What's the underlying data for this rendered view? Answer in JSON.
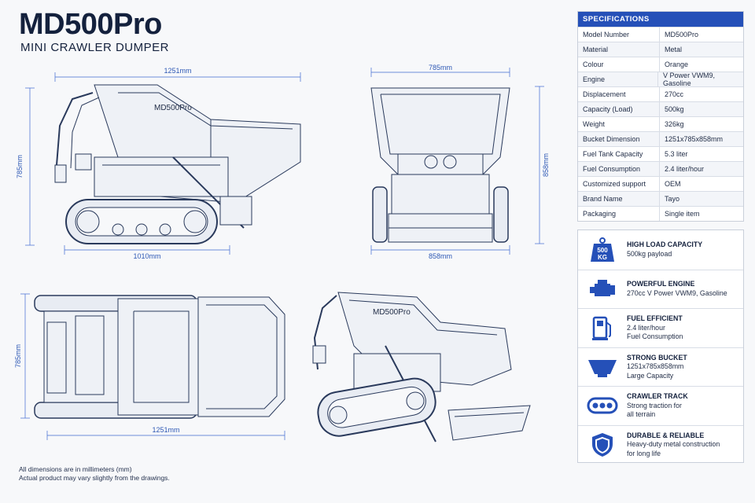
{
  "header": {
    "title": "MD500Pro",
    "subtitle": "MINI CRAWLER DUMPER"
  },
  "drawing": {
    "side_view": {
      "top_length": "1251mm",
      "height": "785mm",
      "track_length": "1010mm",
      "bucket_label": "MD500Pro"
    },
    "front_view": {
      "top_width": "785mm",
      "height": "858mm",
      "bottom_width": "858mm"
    },
    "top_view": {
      "width": "785mm",
      "length": "1251mm"
    },
    "iso_view": {
      "bucket_label": "MD500Pro"
    }
  },
  "notes": {
    "line1": "All dimensions are in millimeters (mm)",
    "line2": "Actual product may vary slightly from the drawings."
  },
  "specifications": {
    "heading": "SPECIFICATIONS",
    "rows": [
      {
        "key": "Model Number",
        "value": "MD500Pro"
      },
      {
        "key": "Material",
        "value": "Metal"
      },
      {
        "key": "Colour",
        "value": "Orange"
      },
      {
        "key": "Engine",
        "value": "V Power VWM9, Gasoline"
      },
      {
        "key": "Displacement",
        "value": "270cc"
      },
      {
        "key": "Capacity (Load)",
        "value": "500kg"
      },
      {
        "key": "Weight",
        "value": "326kg"
      },
      {
        "key": "Bucket Dimension",
        "value": "1251x785x858mm"
      },
      {
        "key": "Fuel Tank Capacity",
        "value": "5.3 liter"
      },
      {
        "key": "Fuel Consumption",
        "value": "2.4 liter/hour"
      },
      {
        "key": "Customized support",
        "value": "OEM"
      },
      {
        "key": "Brand Name",
        "value": "Tayo"
      },
      {
        "key": "Packaging",
        "value": "Single item"
      }
    ]
  },
  "features": [
    {
      "icon": "weight-icon",
      "icon_text_top": "500",
      "icon_text_bottom": "KG",
      "title": "HIGH LOAD CAPACITY",
      "line1": "500kg payload",
      "line2": ""
    },
    {
      "icon": "engine-icon",
      "title": "POWERFUL ENGINE",
      "line1": "270cc V Power VWM9, Gasoline",
      "line2": ""
    },
    {
      "icon": "fuel-pump-icon",
      "title": "FUEL EFFICIENT",
      "line1": "2.4 liter/hour",
      "line2": "Fuel Consumption"
    },
    {
      "icon": "bucket-icon",
      "title": "STRONG BUCKET",
      "line1": "1251x785x858mm",
      "line2": "Large Capacity"
    },
    {
      "icon": "crawler-track-icon",
      "title": "CRAWLER TRACK",
      "line1": "Strong traction for",
      "line2": "all terrain"
    },
    {
      "icon": "shield-icon",
      "title": "DURABLE & RELIABLE",
      "line1": "Heavy-duty metal construction",
      "line2": "for long life"
    }
  ],
  "colors": {
    "accent": "#2550b8",
    "ink": "#14213d",
    "dimension": "#3f6bd1"
  }
}
